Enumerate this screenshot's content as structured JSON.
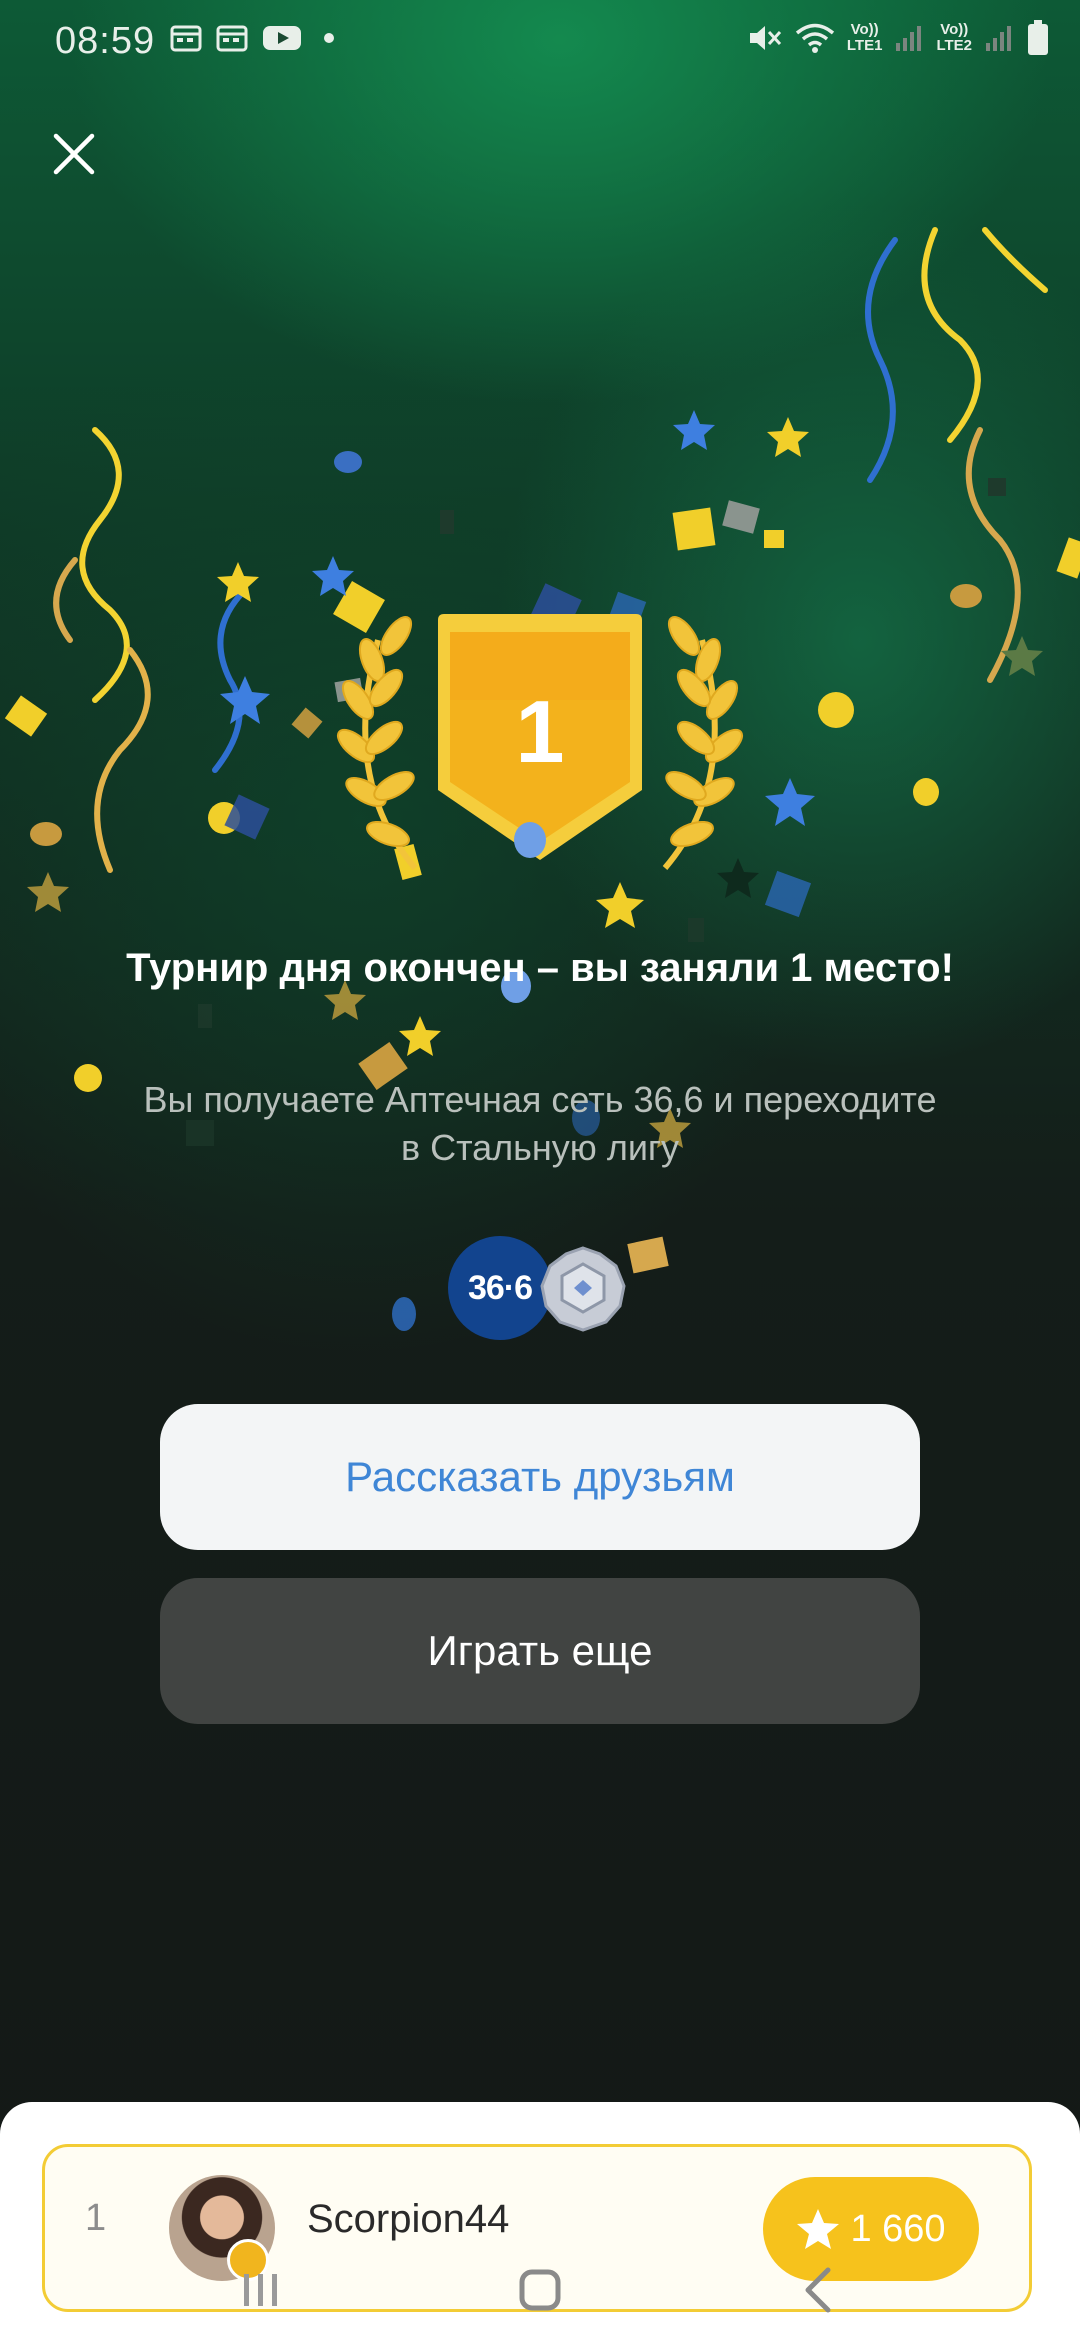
{
  "status_bar": {
    "time": "08:59",
    "sim1_top": "Vo))",
    "sim1_bottom": "LTE1",
    "sim2_top": "Vo))",
    "sim2_bottom": "LTE2"
  },
  "result": {
    "place": "1",
    "title": "Турнир дня окончен – вы заняли 1 место!",
    "subtitle": "Вы получаете Аптечная сеть 36,6 и переходите в Стальную лигу",
    "reward_logo_text": "36·6"
  },
  "buttons": {
    "share": "Рассказать друзьям",
    "play_again": "Играть еще"
  },
  "leaderboard": {
    "rank": "1",
    "name": "Scorpion44",
    "score": "1 660"
  },
  "colors": {
    "accent_blue": "#3f86d6",
    "gold": "#f6c21c",
    "dark_button": "#414442"
  },
  "icons": [
    "close-icon",
    "trophy-shield-icon",
    "laurel-icon",
    "star-icon",
    "league-badge-icon",
    "mute-icon",
    "wifi-icon",
    "battery-icon"
  ]
}
